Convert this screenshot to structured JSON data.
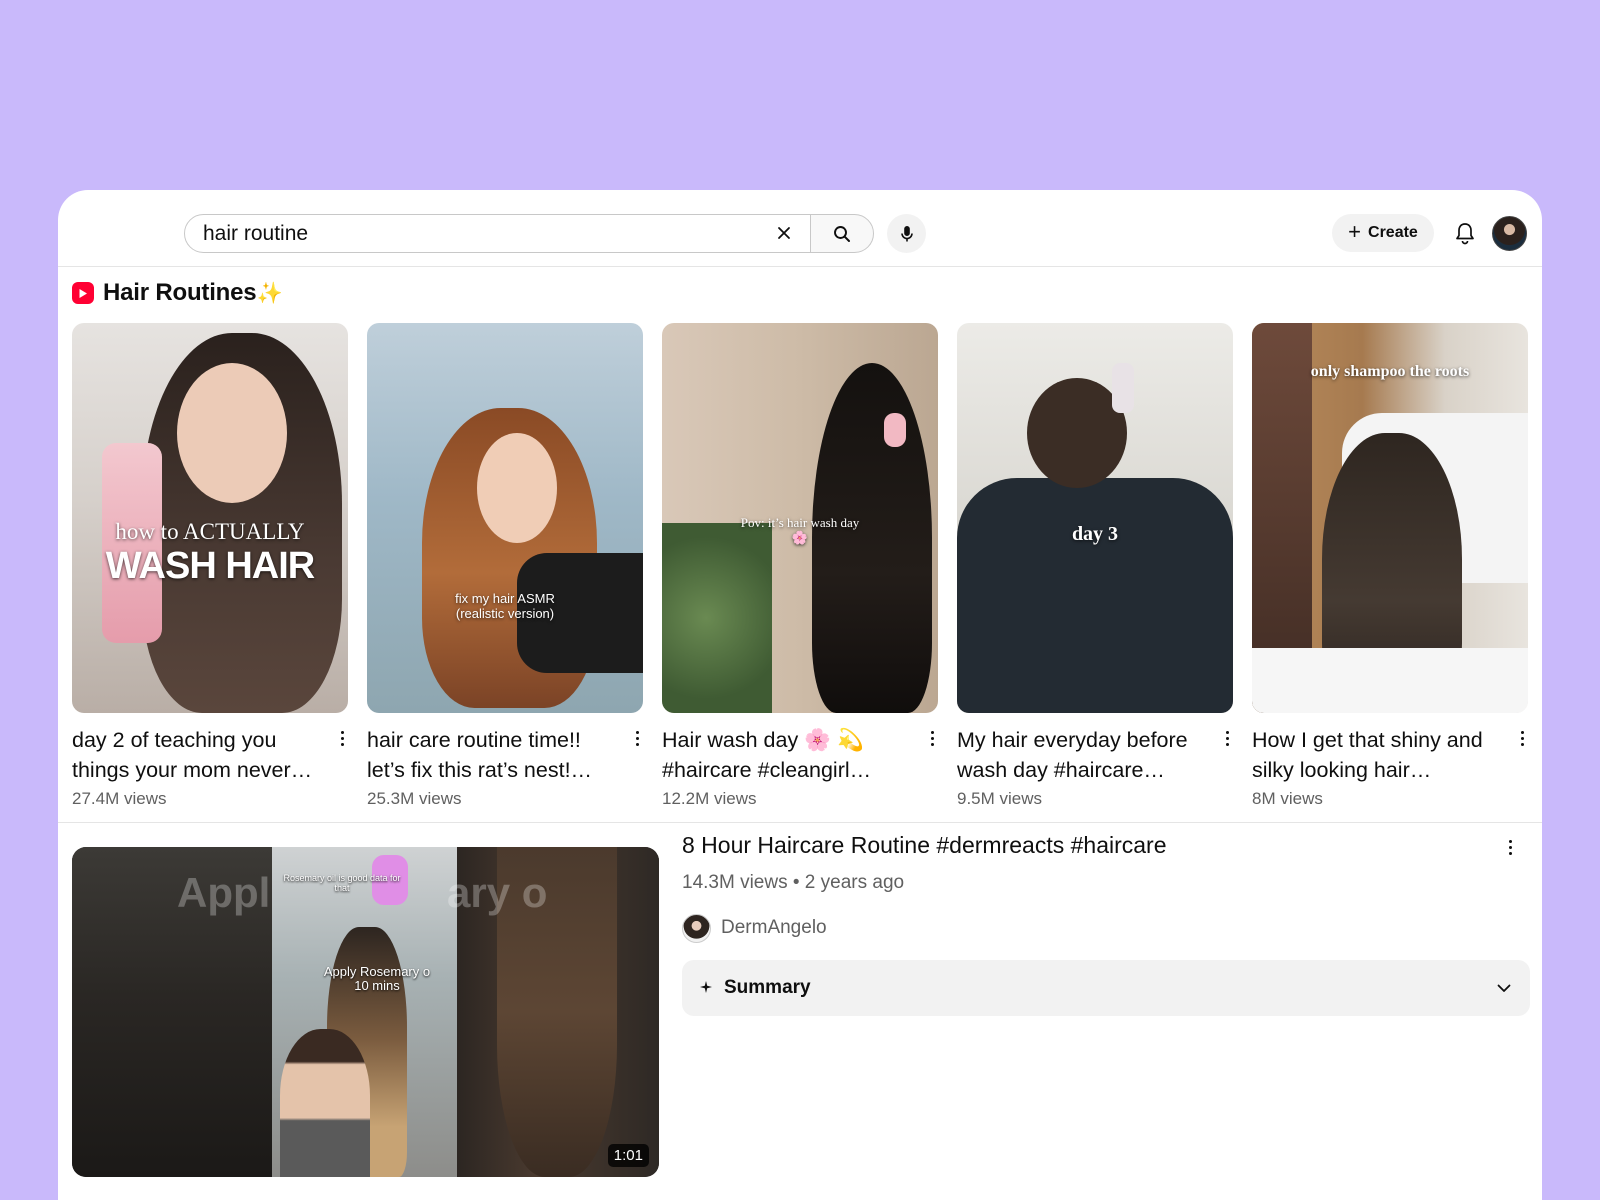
{
  "search": {
    "query": "hair routine",
    "clear_icon": "close-icon",
    "search_icon": "search-icon",
    "mic_icon": "mic-icon"
  },
  "header": {
    "create_label": "Create",
    "notifications_icon": "bell-icon",
    "avatar": "account-avatar"
  },
  "shelf": {
    "title": "Hair Routines",
    "title_emoji": "✨",
    "logo_icon": "shorts-icon",
    "accent_color": "#ff0033",
    "shorts": [
      {
        "title_line1": "day 2 of teaching you",
        "title_line2": "things your mom never…",
        "views": "27.4M views",
        "overlay_line1": "how to ACTUALLY",
        "overlay_line2": "WASH HAIR"
      },
      {
        "title_line1": "hair care routine time!!",
        "title_line2": "let’s fix this rat’s nest!…",
        "views": "25.3M views",
        "overlay_line1": "fix my hair ASMR",
        "overlay_line2": "(realistic version)"
      },
      {
        "title_line1": "Hair wash day 🌸 💫",
        "title_line2": "#haircare #cleangirl…",
        "views": "12.2M views",
        "overlay_line1": "Pov: it’s hair wash day",
        "overlay_line2": "🌸"
      },
      {
        "title_line1": "My hair everyday before",
        "title_line2": "wash day #haircare…",
        "views": "9.5M views",
        "overlay_line1": "day 3",
        "overlay_line2": ""
      },
      {
        "title_line1": "How I get that shiny and",
        "title_line2": "silky looking hair…",
        "views": "8M views",
        "overlay_line1": "only shampoo the roots",
        "overlay_line2": ""
      }
    ]
  },
  "video": {
    "title": "8 Hour Haircare Routine #dermreacts #haircare",
    "meta": "14.3M views • 2 years ago",
    "channel": "DermAngelo",
    "duration": "1:01",
    "overlay_caption_line1": "Apply Rosemary o",
    "overlay_caption_line2": "10 mins",
    "overlay_top_caption": "Rosemary oil is good data for that",
    "ghost_left": "Appl",
    "ghost_right": "ary o",
    "summary_label": "Summary",
    "summary_icon": "sparkle-icon",
    "expand_icon": "chevron-down-icon"
  },
  "colors": {
    "background": "#c9b9fb",
    "surface": "#ffffff",
    "muted_text": "#606060",
    "chip_bg": "#f2f2f2"
  }
}
